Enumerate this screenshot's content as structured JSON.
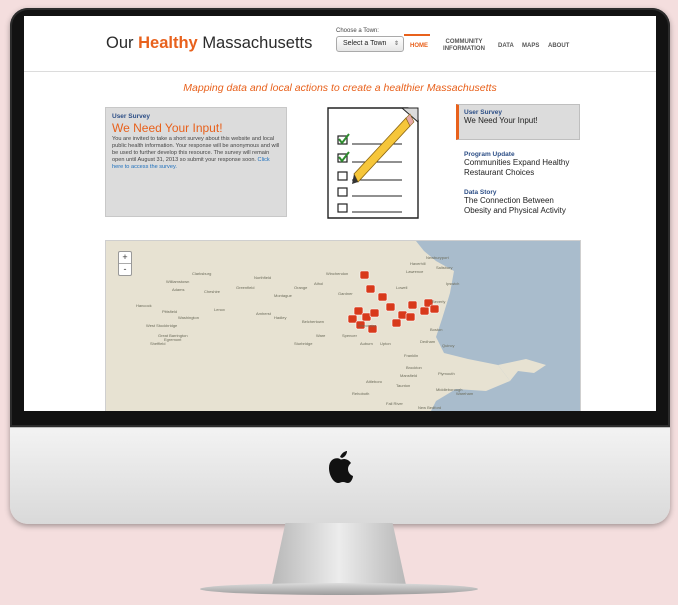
{
  "site": {
    "logo_prefix": "Our",
    "logo_highlight": "Healthy",
    "logo_suffix": "Massachusetts"
  },
  "town_selector": {
    "label": "Choose a Town:",
    "value": "Select a Town"
  },
  "nav": {
    "items": [
      {
        "label": "HOME",
        "active": true
      },
      {
        "label": "COMMUNITY INFORMATION",
        "active": false
      },
      {
        "label": "DATA",
        "active": false
      },
      {
        "label": "MAPS",
        "active": false
      },
      {
        "label": "ABOUT",
        "active": false
      }
    ]
  },
  "tagline": "Mapping data and local actions to create a healthier Massachusetts",
  "survey": {
    "kicker": "User Survey",
    "title": "We Need Your Input!",
    "body": "You are invited to take a short survey about this website and local public health information. Your response will be anonymous and will be used to further develop this resource. The survey will remain open until August 31, 2013 so submit your response soon.",
    "link": "Click here to access the survey."
  },
  "stories": [
    {
      "kicker": "User Survey",
      "title": "We Need Your Input!"
    },
    {
      "kicker": "Program Update",
      "title": "Communities Expand Healthy Restaurant Choices"
    },
    {
      "kicker": "Data Story",
      "title": "The Connection Between Obesity and Physical Activity"
    }
  ],
  "map": {
    "zoom_in": "+",
    "zoom_out": "-",
    "labels": [
      "Clarksburg",
      "Williamstown",
      "Adams",
      "Cheshire",
      "Hancock",
      "Pittsfield",
      "Washington",
      "Lenox",
      "West Stockbridge",
      "Great Barrington",
      "Sheffield",
      "Egremont",
      "Northfield",
      "Winchendon",
      "Greenfield",
      "Montague",
      "Orange",
      "Athol",
      "Gardner",
      "Amherst",
      "Hadley",
      "Belchertown",
      "Ware",
      "Spencer",
      "Worcester",
      "Sturbridge",
      "Auburn",
      "Upton",
      "Franklin",
      "Dedham",
      "Quincy",
      "Boston",
      "Lowell",
      "Lawrence",
      "Newburyport",
      "Salisbury",
      "Haverhill",
      "Ipswich",
      "Beverly",
      "Plymouth",
      "Brockton",
      "Taunton",
      "Mansfield",
      "Attleboro",
      "Fall River",
      "New Bedford",
      "Wareham",
      "Middleborough",
      "Rehoboth"
    ],
    "colors": {
      "land": "#e7e2d2",
      "water": "#a9bccc",
      "marker": "#d8391b"
    }
  },
  "colors": {
    "accent": "#e8611c",
    "link": "#1c6fbd",
    "kicker": "#2c4e86"
  }
}
